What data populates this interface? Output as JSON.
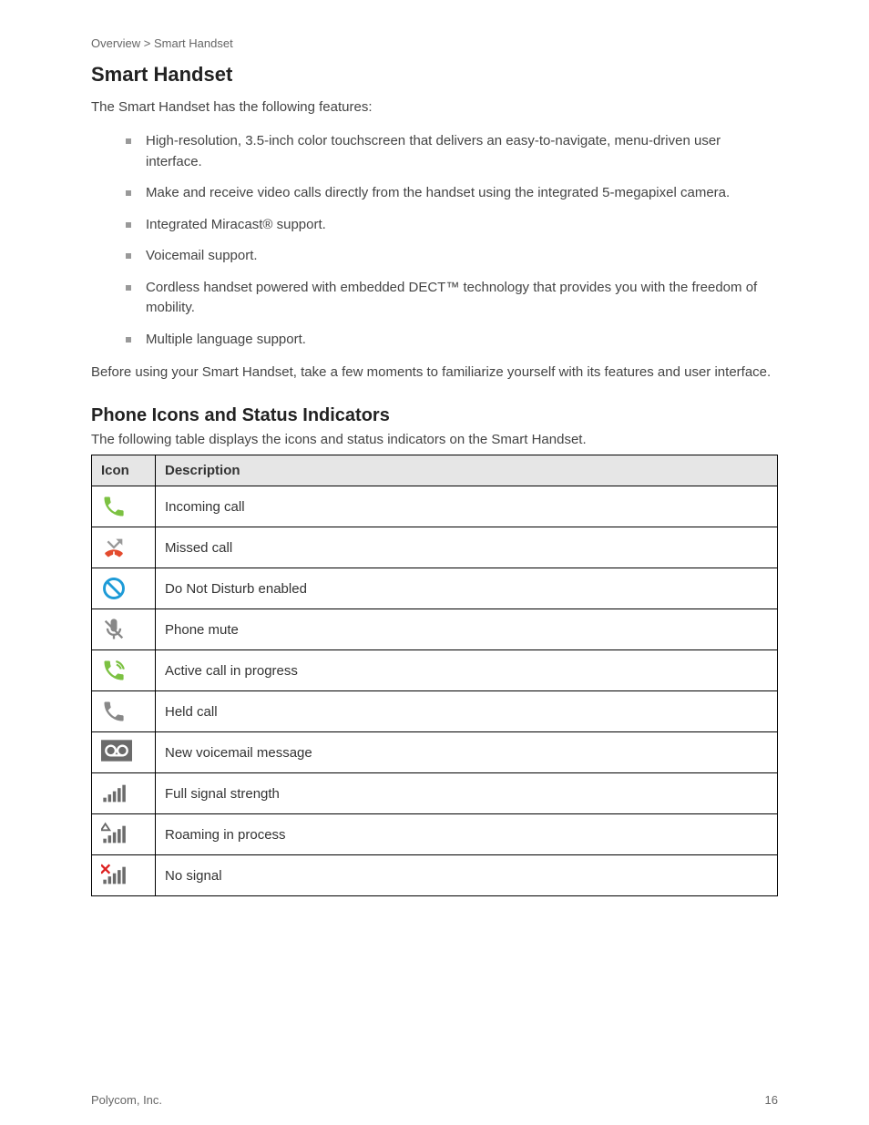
{
  "breadcrumb": "Overview > Smart Handset",
  "section_title": "Smart Handset",
  "intro": "The Smart Handset has the following features:",
  "bullets": [
    "High-resolution, 3.5-inch color touchscreen that delivers an easy-to-navigate, menu-driven user interface.",
    "Make and receive video calls directly from the handset using the integrated 5-megapixel camera.",
    "Integrated Miracast® support.",
    "Voicemail support.",
    "Cordless handset powered with embedded DECT™ technology that provides you with the freedom of mobility.",
    "Multiple language support."
  ],
  "note": "Before using your Smart Handset, take a few moments to familiarize yourself with its features and user interface.",
  "icons_heading": "Phone Icons and Status Indicators",
  "icons_intro": "The following table displays the icons and status indicators on the Smart Handset.",
  "table": {
    "headers": [
      "Icon",
      "Description"
    ],
    "rows": [
      {
        "icon": "phone-call-green-icon",
        "desc": "Incoming call"
      },
      {
        "icon": "missed-call-icon",
        "desc": "Missed call"
      },
      {
        "icon": "dnd-icon",
        "desc": "Do Not Disturb enabled"
      },
      {
        "icon": "mute-mic-icon",
        "desc": "Phone mute"
      },
      {
        "icon": "active-call-icon",
        "desc": "Active call in progress"
      },
      {
        "icon": "held-call-icon",
        "desc": "Held call"
      },
      {
        "icon": "voicemail-icon",
        "desc": "New voicemail message"
      },
      {
        "icon": "signal-full-icon",
        "desc": "Full signal strength"
      },
      {
        "icon": "signal-roam-icon",
        "desc": "Roaming in process"
      },
      {
        "icon": "signal-none-icon",
        "desc": "No signal"
      }
    ]
  },
  "footer_left": "Polycom, Inc.",
  "footer_right": "16"
}
